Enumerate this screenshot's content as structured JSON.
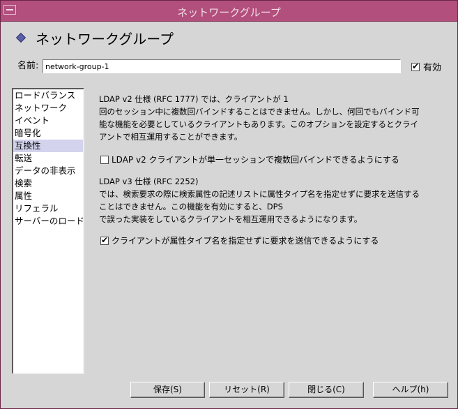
{
  "window": {
    "title": "ネットワークグループ"
  },
  "header": {
    "icon": "diamond-icon",
    "title": "ネットワークグループ"
  },
  "name": {
    "label": "名前:",
    "value": "network-group-1"
  },
  "enabled": {
    "label": "有効",
    "checked": true
  },
  "sidebar": {
    "items": [
      {
        "label": "ロードバランス"
      },
      {
        "label": "ネットワーク"
      },
      {
        "label": "イベント"
      },
      {
        "label": "暗号化"
      },
      {
        "label": "互換性",
        "selected": true
      },
      {
        "label": "転送"
      },
      {
        "label": "データの非表示"
      },
      {
        "label": "検索"
      },
      {
        "label": "属性"
      },
      {
        "label": "リフェラル"
      },
      {
        "label": "サーバーのロード"
      }
    ]
  },
  "content": {
    "ldapv2": {
      "lines": [
        "LDAP v2 仕様 (RFC 1777) では、クライアントが 1",
        "回のセッション中に複数回バインドすることはできません。しかし、何回でもバインド可",
        "能な機能を必要としているクライアントもあります。このオプションを設定するとクライ",
        "アントで相互運用することができます。"
      ],
      "option_label": "LDAP v2 クライアントが単一セッションで複数回バインドできるようにする",
      "option_checked": false
    },
    "ldapv3": {
      "lines": [
        "LDAP v3 仕様 (RFC 2252)",
        "では、検索要求の際に検索属性の記述リストに属性タイプ名を指定せずに要求を送信する",
        "ことはできません。この機能を有効にすると、DPS",
        "で誤った実装をしているクライアントを相互運用できるようになります。"
      ],
      "option_label": "クライアントが属性タイプ名を指定せずに要求を送信できるようにする",
      "option_checked": true
    }
  },
  "buttons": {
    "save": "保存(S)",
    "reset": "リセット(R)",
    "close": "閉じる(C)",
    "help": "ヘルプ(h)"
  }
}
